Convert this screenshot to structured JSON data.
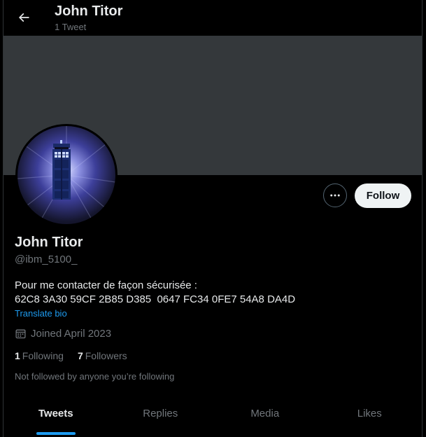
{
  "header": {
    "title": "John Titor",
    "subtitle": "1 Tweet",
    "back_icon": "arrow-left-icon"
  },
  "profile": {
    "name": "John Titor",
    "handle": "@ibm_5100_",
    "bio_line1": "Pour me contacter de façon sécurisée :",
    "bio_line2": "62C8 3A30 59CF 2B85 D385  0647 FC34 0FE7 54A8 DA4D",
    "translate_label": "Translate bio",
    "joined": "Joined April 2023",
    "following_count": "1",
    "following_label": "Following",
    "followers_count": "7",
    "followers_label": "Followers",
    "not_followed_text": "Not followed by anyone you’re following"
  },
  "actions": {
    "follow_label": "Follow",
    "more_icon": "more-horizontal-icon"
  },
  "tabs": [
    {
      "label": "Tweets",
      "active": true
    },
    {
      "label": "Replies",
      "active": false
    },
    {
      "label": "Media",
      "active": false
    },
    {
      "label": "Likes",
      "active": false
    }
  ],
  "colors": {
    "background": "#000000",
    "banner": "#34383b",
    "accent": "#1d9bf0",
    "text_primary": "#e7e9ea",
    "text_secondary": "#71767b"
  }
}
